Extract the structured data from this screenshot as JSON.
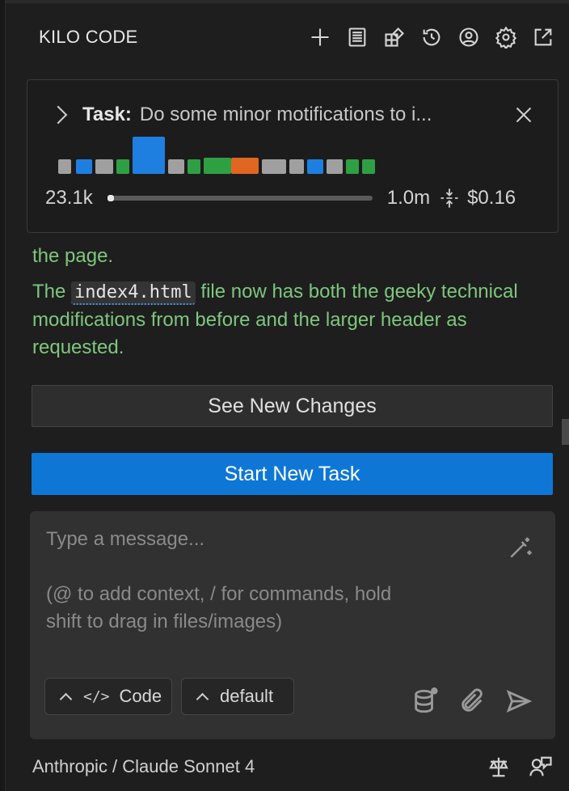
{
  "header": {
    "title": "KILO CODE",
    "icons": [
      "plus-icon",
      "history-list-icon",
      "marketplace-icon",
      "history-clock-icon",
      "account-icon",
      "settings-icon",
      "popout-icon"
    ]
  },
  "task": {
    "label": "Task:",
    "text": "Do some minor motifications to i...",
    "tokens_used": "23.1k",
    "context_window": "1.0m",
    "context_fraction": 0.023,
    "cost": "$0.16",
    "timeline_colors": [
      "#a0a0a0",
      "#1f7fe0",
      "#a0a0a0",
      "#2ea043",
      "#1f7fe0",
      "#a0a0a0",
      "#2ea043",
      "#2ea043",
      "#e06622",
      "#a0a0a0",
      "#a0a0a0",
      "#1f7fe0",
      "#a0a0a0",
      "#2ea043",
      "#2ea043"
    ]
  },
  "message": {
    "line1": "the page.",
    "p_before": "The ",
    "code": "index4.html",
    "p_after": " file now has both the geeky technical modifications from before and the larger header as requested."
  },
  "buttons": {
    "see_changes": "See New Changes",
    "new_task": "Start New Task"
  },
  "composer": {
    "placeholder": "Type a message...\n\n(@ to add context, / for commands, hold\nshift to drag in files/images)",
    "mode_icon": "</>",
    "mode": "Code",
    "profile": "default"
  },
  "footer": {
    "model": "Anthropic / Claude Sonnet 4"
  }
}
